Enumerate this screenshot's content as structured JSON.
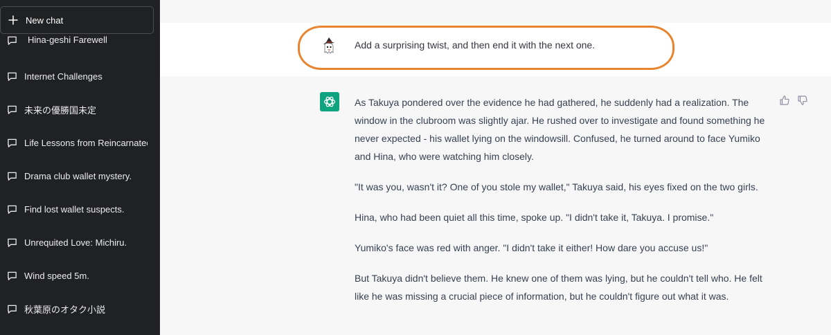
{
  "sidebar": {
    "new_chat_label": "New chat",
    "items": [
      {
        "label": "Hina-geshi Farewell"
      },
      {
        "label": "Internet Challenges"
      },
      {
        "label": "未来の優勝国未定"
      },
      {
        "label": "Life Lessons from Reincarnated"
      },
      {
        "label": "Drama club wallet mystery."
      },
      {
        "label": "Find lost wallet suspects."
      },
      {
        "label": "Unrequited Love: Michiru."
      },
      {
        "label": "Wind speed 5m."
      },
      {
        "label": "秋葉原のオタク小説"
      }
    ]
  },
  "conversation": {
    "user_message": "Add a surprising twist, and then end it with the next one.",
    "assistant_paragraphs": [
      "As Takuya pondered over the evidence he had gathered, he suddenly had a realization. The window in the clubroom was slightly ajar. He rushed over to investigate and found something he never expected - his wallet lying on the windowsill. Confused, he turned around to face Yumiko and Hina, who were watching him closely.",
      "\"It was you, wasn't it? One of you stole my wallet,\" Takuya said, his eyes fixed on the two girls.",
      "Hina, who had been quiet all this time, spoke up. \"I didn't take it, Takuya. I promise.\"",
      "Yumiko's face was red with anger. \"I didn't take it either! How dare you accuse us!\"",
      "But Takuya didn't believe them. He knew one of them was lying, but he couldn't tell who. He felt like he was missing a crucial piece of information, but he couldn't figure out what it was."
    ]
  },
  "colors": {
    "sidebar_bg": "#202123",
    "assistant_bg": "#f7f7f8",
    "gpt_accent": "#10a37f",
    "highlight_annotation": "#e8842f"
  },
  "icons": {
    "new_chat": "plus-icon",
    "chat_item": "chat-bubble-icon",
    "user_avatar": "ghost-witch-avatar",
    "assistant_avatar": "openai-logo-icon",
    "feedback": [
      "thumbs-up-icon",
      "thumbs-down-icon"
    ]
  }
}
